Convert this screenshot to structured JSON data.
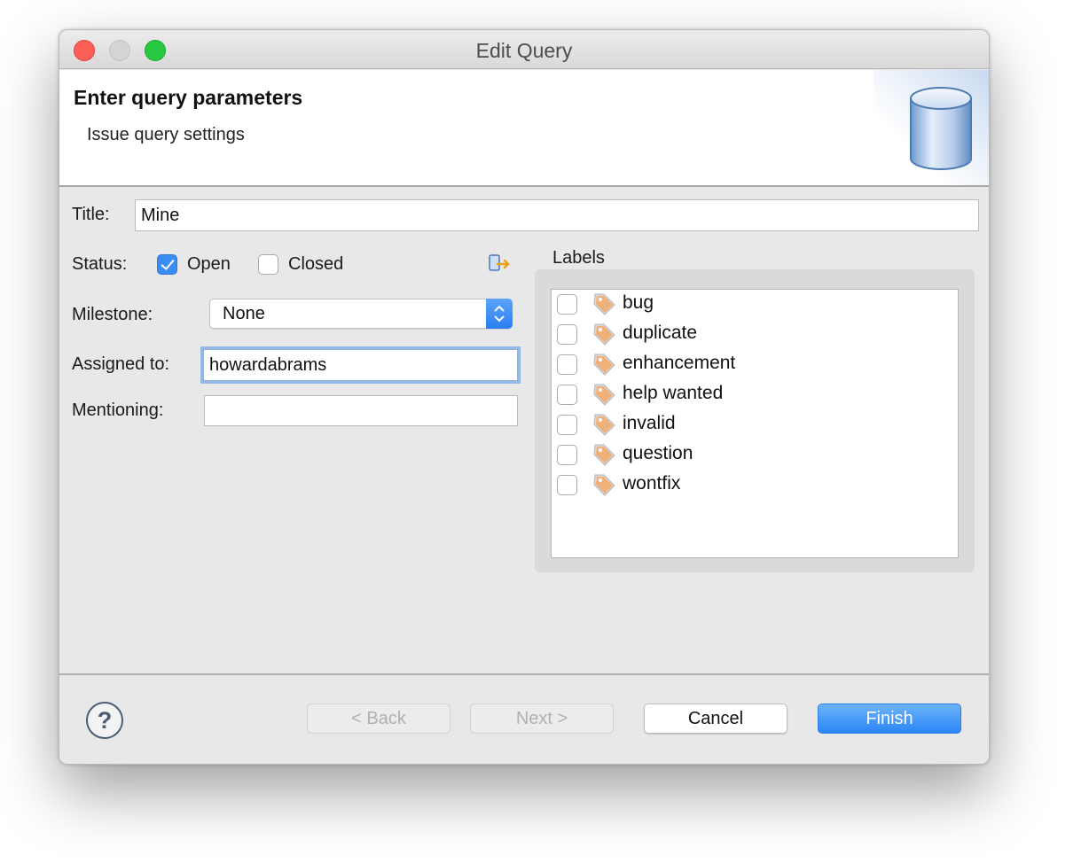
{
  "window": {
    "title": "Edit Query"
  },
  "banner": {
    "heading": "Enter query parameters",
    "subheading": "Issue query settings",
    "icon": "database-icon"
  },
  "form": {
    "title_label": "Title:",
    "title_value": "Mine",
    "status_label": "Status:",
    "status_open_label": "Open",
    "status_open_checked": true,
    "status_closed_label": "Closed",
    "status_closed_checked": false,
    "milestone_label": "Milestone:",
    "milestone_value": "None",
    "assigned_label": "Assigned to:",
    "assigned_value": "howardabrams",
    "mentioning_label": "Mentioning:",
    "mentioning_value": ""
  },
  "labels": {
    "heading": "Labels",
    "items": [
      {
        "name": "bug",
        "checked": false
      },
      {
        "name": "duplicate",
        "checked": false
      },
      {
        "name": "enhancement",
        "checked": false
      },
      {
        "name": "help wanted",
        "checked": false
      },
      {
        "name": "invalid",
        "checked": false
      },
      {
        "name": "question",
        "checked": false
      },
      {
        "name": "wontfix",
        "checked": false
      }
    ]
  },
  "footer": {
    "help_symbol": "?",
    "back_label": "< Back",
    "next_label": "Next >",
    "cancel_label": "Cancel",
    "finish_label": "Finish"
  },
  "colors": {
    "accent": "#2b86f6",
    "tag": "#f3a868"
  }
}
